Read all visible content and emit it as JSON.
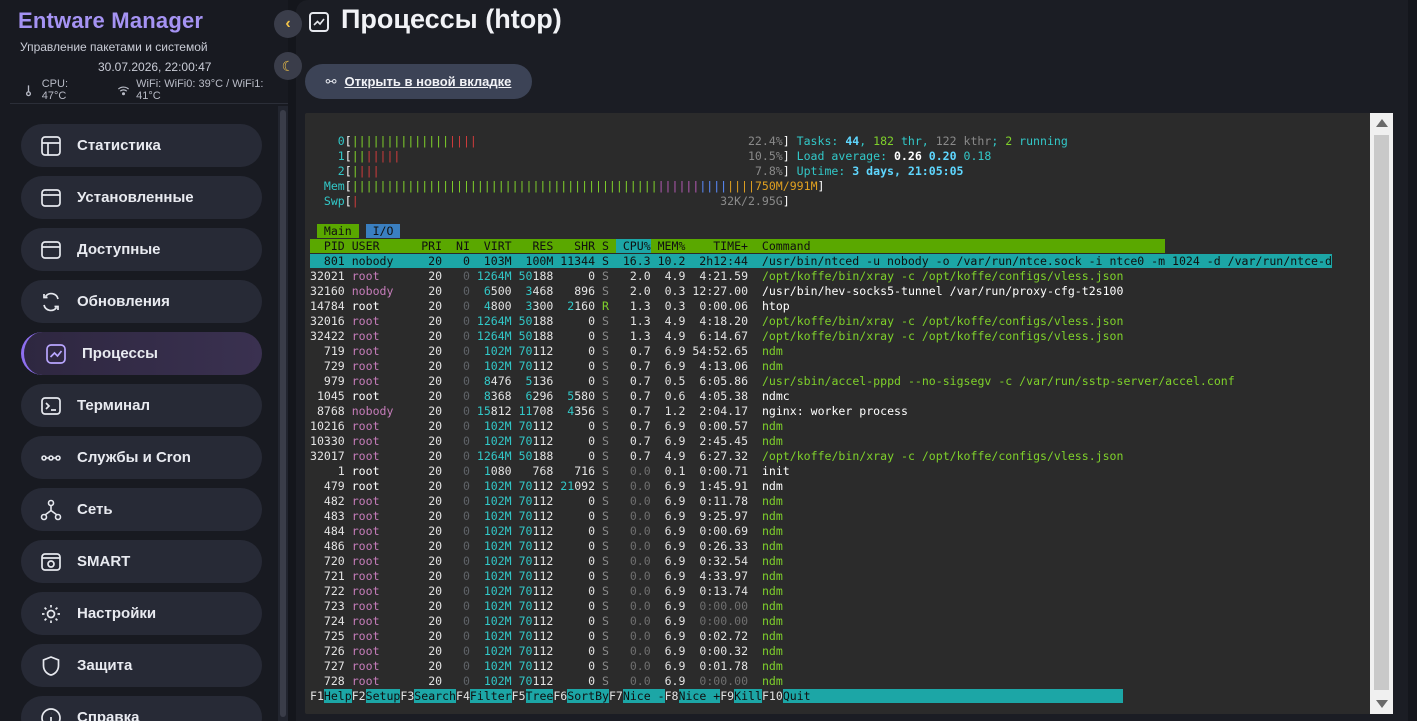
{
  "app": {
    "brand": "Entware Manager",
    "subtitle": "Управление пакетами и системой",
    "datetime": "30.07.2026, 22:00:47",
    "cpu_temp": "CPU: 47°C",
    "wifi_temp": "WiFi: WiFi0: 39°C / WiFi1: 41°C"
  },
  "sidebar": {
    "collapse_glyph": "‹",
    "theme_glyph": "☾",
    "items": [
      {
        "label": "Статистика",
        "icon": "layout-icon"
      },
      {
        "label": "Установленные",
        "icon": "window-icon"
      },
      {
        "label": "Доступные",
        "icon": "window-icon"
      },
      {
        "label": "Обновления",
        "icon": "refresh-icon"
      },
      {
        "label": "Процессы",
        "icon": "chart-icon",
        "active": true
      },
      {
        "label": "Терминал",
        "icon": "terminal-icon"
      },
      {
        "label": "Службы и Cron",
        "icon": "dots-icon"
      },
      {
        "label": "Сеть",
        "icon": "network-icon"
      },
      {
        "label": "SMART",
        "icon": "disk-icon"
      },
      {
        "label": "Настройки",
        "icon": "sun-icon"
      },
      {
        "label": "Защита",
        "icon": "shield-icon"
      },
      {
        "label": "Справка",
        "icon": "info-icon"
      }
    ]
  },
  "main": {
    "title": "Процессы (htop)",
    "open_button_label": "Открыть в новой вкладке",
    "open_button_glyph": "⚯"
  },
  "htop": {
    "cpu_meters": [
      {
        "id": "0",
        "value": "22.4%"
      },
      {
        "id": "1",
        "value": "10.5%"
      },
      {
        "id": "2",
        "value": "7.8%"
      }
    ],
    "mem": {
      "label": "Mem",
      "value": "750M/991M"
    },
    "swp": {
      "label": "Swp",
      "value": "32K/2.95G"
    },
    "tasks": {
      "label": "Tasks:",
      "tasks": "44",
      "thr": "182",
      "kthr": "122",
      "running": "2"
    },
    "load": {
      "label": "Load average:",
      "l1": "0.26",
      "l5": "0.20",
      "l15": "0.18"
    },
    "uptime": {
      "label": "Uptime:",
      "value": "3 days, 21:05:05"
    },
    "tabs": [
      "Main",
      "I/O"
    ],
    "columns": [
      "PID",
      "USER",
      "PRI",
      "NI",
      "VIRT",
      "RES",
      "SHR",
      "S",
      "CPU%",
      "MEM%",
      "TIME+",
      "Command"
    ],
    "rows": [
      {
        "pid": "801",
        "user": "nobody",
        "pri": "20",
        "ni": "0",
        "virt": "103M",
        "res": "100M",
        "shr": "11344",
        "s": "S",
        "cpu": "16.3",
        "mem": "10.2",
        "time": "2h12:44",
        "cmd": "/usr/bin/ntced -u nobody -o /var/run/ntce.sock -i ntce0 -m 1024 -d /var/run/ntce-d",
        "sel": true
      },
      {
        "pid": "32021",
        "user": "root",
        "pri": "20",
        "ni": "0",
        "virt": "1264M",
        "res": "50188",
        "shr": "0",
        "s": "S",
        "cpu": "2.0",
        "mem": "4.9",
        "time": "4:21.59",
        "cmd": "/opt/koffe/bin/xray -c /opt/koffe/configs/vless.json"
      },
      {
        "pid": "32160",
        "user": "nobody",
        "pri": "20",
        "ni": "0",
        "virt": "6500",
        "res": "3468",
        "shr": "896",
        "s": "S",
        "cpu": "2.0",
        "mem": "0.3",
        "time": "12:27.00",
        "cmd": "/usr/bin/hev-socks5-tunnel /var/run/proxy-cfg-t2s100"
      },
      {
        "pid": "14784",
        "user": "root",
        "pri": "20",
        "ni": "0",
        "virt": "4800",
        "res": "3300",
        "shr": "2160",
        "s": "R",
        "cpu": "1.3",
        "mem": "0.3",
        "time": "0:00.06",
        "cmd": "htop"
      },
      {
        "pid": "32016",
        "user": "root",
        "pri": "20",
        "ni": "0",
        "virt": "1264M",
        "res": "50188",
        "shr": "0",
        "s": "S",
        "cpu": "1.3",
        "mem": "4.9",
        "time": "4:18.20",
        "cmd": "/opt/koffe/bin/xray -c /opt/koffe/configs/vless.json"
      },
      {
        "pid": "32422",
        "user": "root",
        "pri": "20",
        "ni": "0",
        "virt": "1264M",
        "res": "50188",
        "shr": "0",
        "s": "S",
        "cpu": "1.3",
        "mem": "4.9",
        "time": "6:14.67",
        "cmd": "/opt/koffe/bin/xray -c /opt/koffe/configs/vless.json"
      },
      {
        "pid": "719",
        "user": "root",
        "pri": "20",
        "ni": "0",
        "virt": "102M",
        "res": "70112",
        "shr": "0",
        "s": "S",
        "cpu": "0.7",
        "mem": "6.9",
        "time": "54:52.65",
        "cmd": "ndm"
      },
      {
        "pid": "729",
        "user": "root",
        "pri": "20",
        "ni": "0",
        "virt": "102M",
        "res": "70112",
        "shr": "0",
        "s": "S",
        "cpu": "0.7",
        "mem": "6.9",
        "time": "4:13.06",
        "cmd": "ndm"
      },
      {
        "pid": "979",
        "user": "root",
        "pri": "20",
        "ni": "0",
        "virt": "8476",
        "res": "5136",
        "shr": "0",
        "s": "S",
        "cpu": "0.7",
        "mem": "0.5",
        "time": "6:05.86",
        "cmd": "/usr/sbin/accel-pppd --no-sigsegv -c /var/run/sstp-server/accel.conf"
      },
      {
        "pid": "1045",
        "user": "root",
        "pri": "20",
        "ni": "0",
        "virt": "8368",
        "res": "6296",
        "shr": "5580",
        "s": "S",
        "cpu": "0.7",
        "mem": "0.6",
        "time": "4:05.38",
        "cmd": "ndmc"
      },
      {
        "pid": "8768",
        "user": "nobody",
        "pri": "20",
        "ni": "0",
        "virt": "15812",
        "res": "11708",
        "shr": "4356",
        "s": "S",
        "cpu": "0.7",
        "mem": "1.2",
        "time": "2:04.17",
        "cmd": "nginx: worker process"
      },
      {
        "pid": "10216",
        "user": "root",
        "pri": "20",
        "ni": "0",
        "virt": "102M",
        "res": "70112",
        "shr": "0",
        "s": "S",
        "cpu": "0.7",
        "mem": "6.9",
        "time": "0:00.57",
        "cmd": "ndm"
      },
      {
        "pid": "10330",
        "user": "root",
        "pri": "20",
        "ni": "0",
        "virt": "102M",
        "res": "70112",
        "shr": "0",
        "s": "S",
        "cpu": "0.7",
        "mem": "6.9",
        "time": "2:45.45",
        "cmd": "ndm"
      },
      {
        "pid": "32017",
        "user": "root",
        "pri": "20",
        "ni": "0",
        "virt": "1264M",
        "res": "50188",
        "shr": "0",
        "s": "S",
        "cpu": "0.7",
        "mem": "4.9",
        "time": "6:27.32",
        "cmd": "/opt/koffe/bin/xray -c /opt/koffe/configs/vless.json"
      },
      {
        "pid": "1",
        "user": "root",
        "pri": "20",
        "ni": "0",
        "virt": "1080",
        "res": "768",
        "shr": "716",
        "s": "S",
        "cpu": "0.0",
        "mem": "0.1",
        "time": "0:00.71",
        "cmd": "init"
      },
      {
        "pid": "479",
        "user": "root",
        "pri": "20",
        "ni": "0",
        "virt": "102M",
        "res": "70112",
        "shr": "21092",
        "s": "S",
        "cpu": "0.0",
        "mem": "6.9",
        "time": "1:45.91",
        "cmd": "ndm"
      },
      {
        "pid": "482",
        "user": "root",
        "pri": "20",
        "ni": "0",
        "virt": "102M",
        "res": "70112",
        "shr": "0",
        "s": "S",
        "cpu": "0.0",
        "mem": "6.9",
        "time": "0:11.78",
        "cmd": "ndm"
      },
      {
        "pid": "483",
        "user": "root",
        "pri": "20",
        "ni": "0",
        "virt": "102M",
        "res": "70112",
        "shr": "0",
        "s": "S",
        "cpu": "0.0",
        "mem": "6.9",
        "time": "9:25.97",
        "cmd": "ndm"
      },
      {
        "pid": "484",
        "user": "root",
        "pri": "20",
        "ni": "0",
        "virt": "102M",
        "res": "70112",
        "shr": "0",
        "s": "S",
        "cpu": "0.0",
        "mem": "6.9",
        "time": "0:00.69",
        "cmd": "ndm"
      },
      {
        "pid": "486",
        "user": "root",
        "pri": "20",
        "ni": "0",
        "virt": "102M",
        "res": "70112",
        "shr": "0",
        "s": "S",
        "cpu": "0.0",
        "mem": "6.9",
        "time": "0:26.33",
        "cmd": "ndm"
      },
      {
        "pid": "720",
        "user": "root",
        "pri": "20",
        "ni": "0",
        "virt": "102M",
        "res": "70112",
        "shr": "0",
        "s": "S",
        "cpu": "0.0",
        "mem": "6.9",
        "time": "0:32.54",
        "cmd": "ndm"
      },
      {
        "pid": "721",
        "user": "root",
        "pri": "20",
        "ni": "0",
        "virt": "102M",
        "res": "70112",
        "shr": "0",
        "s": "S",
        "cpu": "0.0",
        "mem": "6.9",
        "time": "4:33.97",
        "cmd": "ndm"
      },
      {
        "pid": "722",
        "user": "root",
        "pri": "20",
        "ni": "0",
        "virt": "102M",
        "res": "70112",
        "shr": "0",
        "s": "S",
        "cpu": "0.0",
        "mem": "6.9",
        "time": "0:13.74",
        "cmd": "ndm"
      },
      {
        "pid": "723",
        "user": "root",
        "pri": "20",
        "ni": "0",
        "virt": "102M",
        "res": "70112",
        "shr": "0",
        "s": "S",
        "cpu": "0.0",
        "mem": "6.9",
        "time": "0:00.00",
        "cmd": "ndm"
      },
      {
        "pid": "724",
        "user": "root",
        "pri": "20",
        "ni": "0",
        "virt": "102M",
        "res": "70112",
        "shr": "0",
        "s": "S",
        "cpu": "0.0",
        "mem": "6.9",
        "time": "0:00.00",
        "cmd": "ndm"
      },
      {
        "pid": "725",
        "user": "root",
        "pri": "20",
        "ni": "0",
        "virt": "102M",
        "res": "70112",
        "shr": "0",
        "s": "S",
        "cpu": "0.0",
        "mem": "6.9",
        "time": "0:02.72",
        "cmd": "ndm"
      },
      {
        "pid": "726",
        "user": "root",
        "pri": "20",
        "ni": "0",
        "virt": "102M",
        "res": "70112",
        "shr": "0",
        "s": "S",
        "cpu": "0.0",
        "mem": "6.9",
        "time": "0:00.32",
        "cmd": "ndm"
      },
      {
        "pid": "727",
        "user": "root",
        "pri": "20",
        "ni": "0",
        "virt": "102M",
        "res": "70112",
        "shr": "0",
        "s": "S",
        "cpu": "0.0",
        "mem": "6.9",
        "time": "0:01.78",
        "cmd": "ndm"
      },
      {
        "pid": "728",
        "user": "root",
        "pri": "20",
        "ni": "0",
        "virt": "102M",
        "res": "70112",
        "shr": "0",
        "s": "S",
        "cpu": "0.0",
        "mem": "6.9",
        "time": "0:00.00",
        "cmd": "ndm"
      }
    ],
    "function_keys": [
      {
        "key": "F1",
        "label": "Help"
      },
      {
        "key": "F2",
        "label": "Setup"
      },
      {
        "key": "F3",
        "label": "Search"
      },
      {
        "key": "F4",
        "label": "Filter"
      },
      {
        "key": "F5",
        "label": "Tree"
      },
      {
        "key": "F6",
        "label": "SortBy"
      },
      {
        "key": "F7",
        "label": "Nice -"
      },
      {
        "key": "F8",
        "label": "Nice +"
      },
      {
        "key": "F9",
        "label": "Kill"
      },
      {
        "key": "F10",
        "label": "Quit"
      }
    ]
  },
  "colors": {
    "brand": "#a593f3",
    "accent": "#8e6ff0",
    "htop_header": "#5aa800",
    "htop_select": "#1ca6a6"
  }
}
